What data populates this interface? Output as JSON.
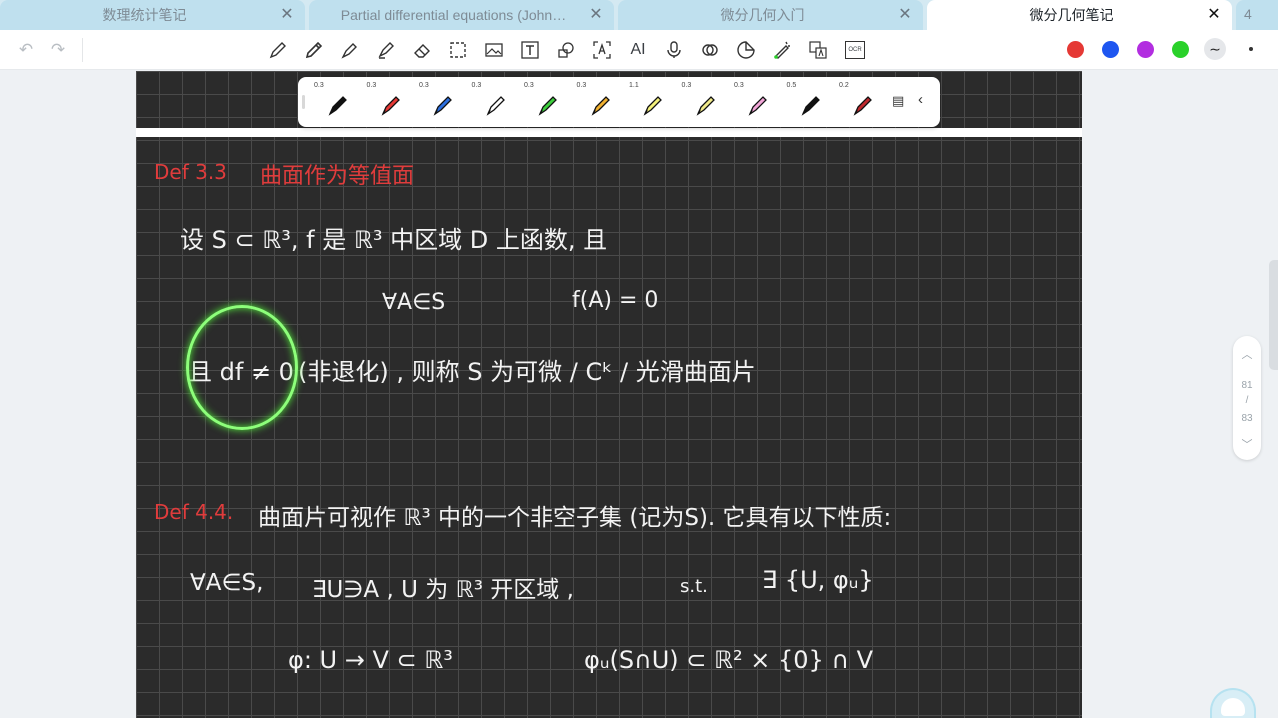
{
  "tabs": [
    {
      "label": "数理统计笔记",
      "active": false
    },
    {
      "label": "Partial differential equations (John…",
      "active": false
    },
    {
      "label": "微分几何入门",
      "active": false
    },
    {
      "label": "微分几何笔记",
      "active": true
    }
  ],
  "tab_overflow_count": "4",
  "toolbar": {
    "tools": [
      "undo-icon",
      "redo-icon",
      "pen-icon",
      "pencil-icon",
      "fountain-pen-icon",
      "highlighter-icon",
      "eraser-icon",
      "lasso-select-icon",
      "image-icon",
      "text-icon",
      "shape-icon",
      "text-recognition-icon",
      "ai-icon",
      "microphone-icon",
      "link-icon",
      "sticker-icon",
      "laser-pointer-icon",
      "translate-icon",
      "ocr-icon"
    ],
    "ai_label": "AI",
    "ocr_label": "OCR",
    "colors": [
      "#e53935",
      "#1e56f0",
      "#b22ee0",
      "#2ad12a"
    ]
  },
  "pens": [
    {
      "width": "0.3",
      "color": "#111111"
    },
    {
      "width": "0.3",
      "color": "#e53935"
    },
    {
      "width": "0.3",
      "color": "#2c6fe0"
    },
    {
      "width": "0.3",
      "color": "#ffffff"
    },
    {
      "width": "0.3",
      "color": "#3ecf3e"
    },
    {
      "width": "0.3",
      "color": "#f0b030"
    },
    {
      "width": "1.1",
      "color": "#f3f07a"
    },
    {
      "width": "0.3",
      "color": "#f1ea8a"
    },
    {
      "width": "0.3",
      "color": "#f2a6d8"
    },
    {
      "width": "0.5",
      "color": "#111111"
    },
    {
      "width": "0.2",
      "color": "#c0282d"
    }
  ],
  "note": {
    "def33_title": "Def 3.3",
    "def33_heading": "曲面作为等值面",
    "line1": "设 S ⊂ ℝ³,   f 是 ℝ³ 中区域 D 上函数, 且",
    "line2a": "∀A∈S",
    "line2b": "f(A) = 0",
    "line3a": "且 df ≠ 0",
    "line3b": "(非退化) , 则称 S 为可微 / Cᵏ / 光滑曲面片",
    "def44_title": "Def 4.4.",
    "def44_text": "曲面片可视作 ℝ³ 中的一个非空子集  (记为S). 它具有以下性质:",
    "line5a": "∀A∈S,",
    "line5b": "∃U∋A , U 为 ℝ³ 开区域 ,",
    "line5c": "s.t.",
    "line5d": "∃ {U, φᵤ}",
    "line6a": "φ: U → V ⊂ ℝ³",
    "line6b": "φᵤ(S∩U) ⊂ ℝ² × {0} ∩ V"
  },
  "pager": {
    "current": "81",
    "separator": "/",
    "total": "83"
  }
}
